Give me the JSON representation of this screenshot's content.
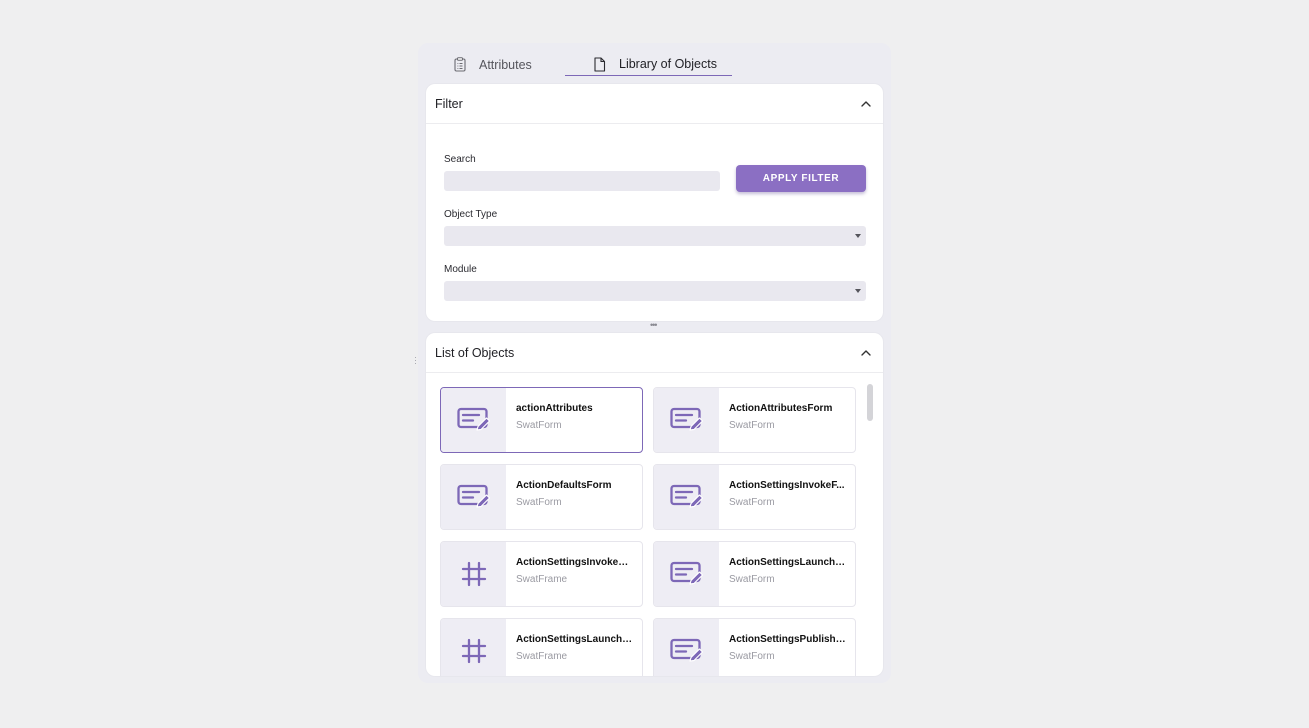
{
  "tabs": [
    {
      "label": "Attributes",
      "icon": "clipboard-icon"
    },
    {
      "label": "Library of Objects",
      "icon": "document-icon"
    }
  ],
  "filter": {
    "title": "Filter",
    "search_label": "Search",
    "search_value": "",
    "apply_label": "APPLY FILTER",
    "object_type_label": "Object Type",
    "object_type_value": "",
    "module_label": "Module",
    "module_value": ""
  },
  "list": {
    "title": "List of Objects",
    "items": [
      {
        "name": "actionAttributes",
        "type": "SwatForm",
        "icon": "form-edit-icon"
      },
      {
        "name": "ActionAttributesForm",
        "type": "SwatForm",
        "icon": "form-edit-icon"
      },
      {
        "name": "ActionDefaultsForm",
        "type": "SwatForm",
        "icon": "form-edit-icon"
      },
      {
        "name": "ActionSettingsInvokeF...",
        "type": "SwatForm",
        "icon": "form-edit-icon"
      },
      {
        "name": "ActionSettingsInvokeFr...",
        "type": "SwatFrame",
        "icon": "frame-icon"
      },
      {
        "name": "ActionSettingsLaunchF...",
        "type": "SwatForm",
        "icon": "form-edit-icon"
      },
      {
        "name": "ActionSettingsLaunchF...",
        "type": "SwatFrame",
        "icon": "frame-icon"
      },
      {
        "name": "ActionSettingsPublishF...",
        "type": "SwatForm",
        "icon": "form-edit-icon"
      }
    ]
  },
  "colors": {
    "accent": "#8b6fc3",
    "icon": "#7d68b7",
    "background": "#efeff0"
  }
}
